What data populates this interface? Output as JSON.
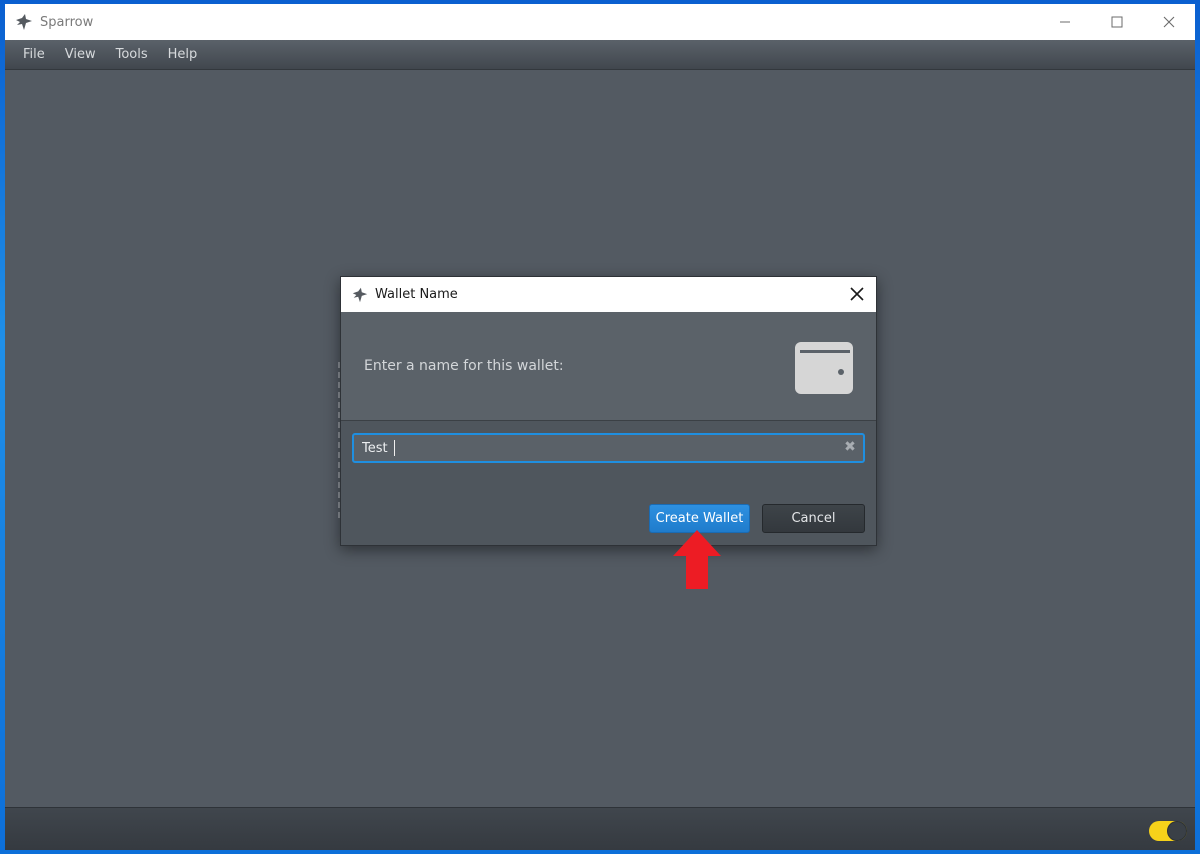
{
  "window": {
    "title": "Sparrow",
    "controls": {
      "minimize": "minimize-icon",
      "maximize": "maximize-icon",
      "close": "close-icon"
    }
  },
  "menubar": {
    "items": [
      {
        "label": "File"
      },
      {
        "label": "View"
      },
      {
        "label": "Tools"
      },
      {
        "label": "Help"
      }
    ]
  },
  "dialog": {
    "title": "Wallet Name",
    "prompt": "Enter a name for this wallet:",
    "header_icon": "wallet-icon",
    "name_field": {
      "value": "Test",
      "placeholder": ""
    },
    "clear_icon": "✖",
    "buttons": {
      "create": "Create Wallet",
      "cancel": "Cancel"
    }
  },
  "statusbar": {
    "toggle": {
      "state": "on",
      "color": "#f6d21a"
    }
  },
  "annotation": {
    "type": "red-arrow",
    "points_to": "Create Wallet",
    "color": "#ed1c24"
  },
  "colors": {
    "accent": "#1f8fe0",
    "background": "#535a62"
  }
}
